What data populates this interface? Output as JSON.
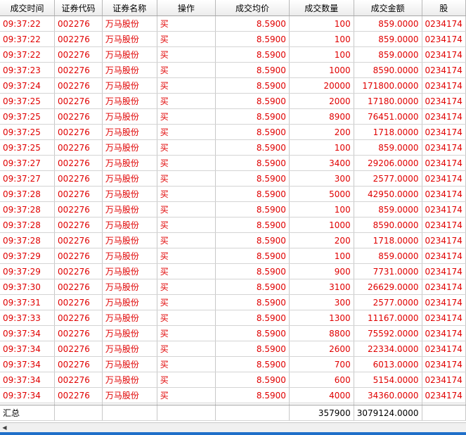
{
  "columns": [
    "成交时间",
    "证券代码",
    "证券名称",
    "操作",
    "成交均价",
    "成交数量",
    "成交金额",
    "股"
  ],
  "rows": [
    {
      "time": "09:37:22",
      "code": "002276",
      "name": "万马股份",
      "op": "买",
      "price": "8.5900",
      "qty": "100",
      "amount": "859.0000",
      "acct": "0234174"
    },
    {
      "time": "09:37:22",
      "code": "002276",
      "name": "万马股份",
      "op": "买",
      "price": "8.5900",
      "qty": "100",
      "amount": "859.0000",
      "acct": "0234174"
    },
    {
      "time": "09:37:22",
      "code": "002276",
      "name": "万马股份",
      "op": "买",
      "price": "8.5900",
      "qty": "100",
      "amount": "859.0000",
      "acct": "0234174"
    },
    {
      "time": "09:37:23",
      "code": "002276",
      "name": "万马股份",
      "op": "买",
      "price": "8.5900",
      "qty": "1000",
      "amount": "8590.0000",
      "acct": "0234174"
    },
    {
      "time": "09:37:24",
      "code": "002276",
      "name": "万马股份",
      "op": "买",
      "price": "8.5900",
      "qty": "20000",
      "amount": "171800.0000",
      "acct": "0234174"
    },
    {
      "time": "09:37:25",
      "code": "002276",
      "name": "万马股份",
      "op": "买",
      "price": "8.5900",
      "qty": "2000",
      "amount": "17180.0000",
      "acct": "0234174"
    },
    {
      "time": "09:37:25",
      "code": "002276",
      "name": "万马股份",
      "op": "买",
      "price": "8.5900",
      "qty": "8900",
      "amount": "76451.0000",
      "acct": "0234174"
    },
    {
      "time": "09:37:25",
      "code": "002276",
      "name": "万马股份",
      "op": "买",
      "price": "8.5900",
      "qty": "200",
      "amount": "1718.0000",
      "acct": "0234174"
    },
    {
      "time": "09:37:25",
      "code": "002276",
      "name": "万马股份",
      "op": "买",
      "price": "8.5900",
      "qty": "100",
      "amount": "859.0000",
      "acct": "0234174"
    },
    {
      "time": "09:37:27",
      "code": "002276",
      "name": "万马股份",
      "op": "买",
      "price": "8.5900",
      "qty": "3400",
      "amount": "29206.0000",
      "acct": "0234174"
    },
    {
      "time": "09:37:27",
      "code": "002276",
      "name": "万马股份",
      "op": "买",
      "price": "8.5900",
      "qty": "300",
      "amount": "2577.0000",
      "acct": "0234174"
    },
    {
      "time": "09:37:28",
      "code": "002276",
      "name": "万马股份",
      "op": "买",
      "price": "8.5900",
      "qty": "5000",
      "amount": "42950.0000",
      "acct": "0234174"
    },
    {
      "time": "09:37:28",
      "code": "002276",
      "name": "万马股份",
      "op": "买",
      "price": "8.5900",
      "qty": "100",
      "amount": "859.0000",
      "acct": "0234174"
    },
    {
      "time": "09:37:28",
      "code": "002276",
      "name": "万马股份",
      "op": "买",
      "price": "8.5900",
      "qty": "1000",
      "amount": "8590.0000",
      "acct": "0234174"
    },
    {
      "time": "09:37:28",
      "code": "002276",
      "name": "万马股份",
      "op": "买",
      "price": "8.5900",
      "qty": "200",
      "amount": "1718.0000",
      "acct": "0234174"
    },
    {
      "time": "09:37:29",
      "code": "002276",
      "name": "万马股份",
      "op": "买",
      "price": "8.5900",
      "qty": "100",
      "amount": "859.0000",
      "acct": "0234174"
    },
    {
      "time": "09:37:29",
      "code": "002276",
      "name": "万马股份",
      "op": "买",
      "price": "8.5900",
      "qty": "900",
      "amount": "7731.0000",
      "acct": "0234174"
    },
    {
      "time": "09:37:30",
      "code": "002276",
      "name": "万马股份",
      "op": "买",
      "price": "8.5900",
      "qty": "3100",
      "amount": "26629.0000",
      "acct": "0234174"
    },
    {
      "time": "09:37:31",
      "code": "002276",
      "name": "万马股份",
      "op": "买",
      "price": "8.5900",
      "qty": "300",
      "amount": "2577.0000",
      "acct": "0234174"
    },
    {
      "time": "09:37:33",
      "code": "002276",
      "name": "万马股份",
      "op": "买",
      "price": "8.5900",
      "qty": "1300",
      "amount": "11167.0000",
      "acct": "0234174"
    },
    {
      "time": "09:37:34",
      "code": "002276",
      "name": "万马股份",
      "op": "买",
      "price": "8.5900",
      "qty": "8800",
      "amount": "75592.0000",
      "acct": "0234174"
    },
    {
      "time": "09:37:34",
      "code": "002276",
      "name": "万马股份",
      "op": "买",
      "price": "8.5900",
      "qty": "2600",
      "amount": "22334.0000",
      "acct": "0234174"
    },
    {
      "time": "09:37:34",
      "code": "002276",
      "name": "万马股份",
      "op": "买",
      "price": "8.5900",
      "qty": "700",
      "amount": "6013.0000",
      "acct": "0234174"
    },
    {
      "time": "09:37:34",
      "code": "002276",
      "name": "万马股份",
      "op": "买",
      "price": "8.5900",
      "qty": "600",
      "amount": "5154.0000",
      "acct": "0234174"
    },
    {
      "time": "09:37:34",
      "code": "002276",
      "name": "万马股份",
      "op": "买",
      "price": "8.5900",
      "qty": "4000",
      "amount": "34360.0000",
      "acct": "0234174"
    }
  ],
  "summary": {
    "label": "汇总",
    "qty": "357900",
    "amount": "3079124.0000"
  },
  "scrollbar": {
    "left_arrow": "◀"
  },
  "colors": {
    "trade_text": "#e00000",
    "taskbar": "#1f6fc9"
  }
}
